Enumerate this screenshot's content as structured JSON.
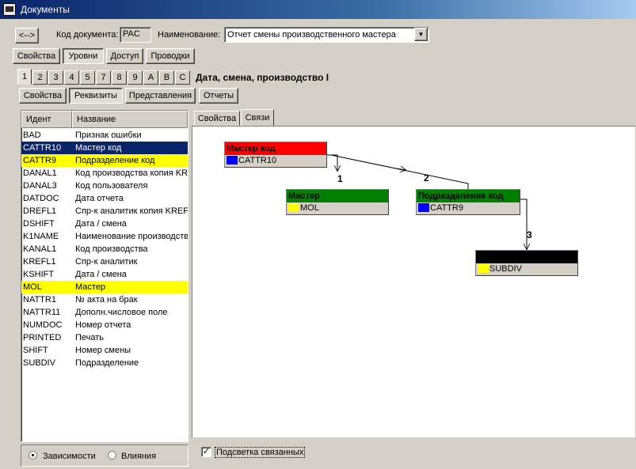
{
  "window": {
    "title": "Документы"
  },
  "header": {
    "nav_button_label": "<-->",
    "doc_code_label": "Код документа:",
    "doc_code_value": "PAC",
    "name_label": "Наименование:",
    "name_value": "Отчет смены производственного мастера"
  },
  "top_tabs": [
    "Свойства",
    "Уровни",
    "Доступ",
    "Проводки"
  ],
  "level_tabs": {
    "items": [
      "1",
      "2",
      "3",
      "4",
      "5",
      "7",
      "8",
      "9",
      "A",
      "B",
      "C"
    ],
    "caption": "Дата, смена, производство I"
  },
  "section_tabs": [
    "Свойства",
    "Реквизиты",
    "Представления",
    "Отчеты"
  ],
  "list": {
    "col_id": "Идент",
    "col_name": "Название",
    "rows": [
      {
        "id": "BAD",
        "name": "Признак ошибки"
      },
      {
        "id": "CATTR10",
        "name": "Мастер код"
      },
      {
        "id": "CATTR9",
        "name": "Подразделение код"
      },
      {
        "id": "DANAL1",
        "name": "Код производства копия KR"
      },
      {
        "id": "DANAL3",
        "name": "Код пользователя"
      },
      {
        "id": "DATDOC",
        "name": "Дата отчета"
      },
      {
        "id": "DREFL1",
        "name": "Спр-к аналитик копия KREF"
      },
      {
        "id": "DSHIFT",
        "name": "Дата / смена"
      },
      {
        "id": "K1NAME",
        "name": "Наименование производстве"
      },
      {
        "id": "KANAL1",
        "name": "Код производства"
      },
      {
        "id": "KREFL1",
        "name": "Спр-к аналитик"
      },
      {
        "id": "KSHIFT",
        "name": "Дата / смена"
      },
      {
        "id": "MOL",
        "name": "Мастер"
      },
      {
        "id": "NATTR1",
        "name": "№ акта на брак"
      },
      {
        "id": "NATTR11",
        "name": "Дополн.числовое поле"
      },
      {
        "id": "NUMDOC",
        "name": "Номер отчета"
      },
      {
        "id": "PRINTED",
        "name": "Печать"
      },
      {
        "id": "SHIFT",
        "name": "Номер смены"
      },
      {
        "id": "SUBDIV",
        "name": "Подразделение"
      }
    ]
  },
  "radio": {
    "dependencies": "Зависимости",
    "influences": "Влияния"
  },
  "right_tabs": [
    "Свойства",
    "Связи"
  ],
  "diagram": {
    "nodes": [
      {
        "title": "Мастер код",
        "field": "CATTR10",
        "header_color": "#ff0000",
        "swatch_color": "#0000ff"
      },
      {
        "title": "Мастер",
        "field": "MOL",
        "header_color": "#008000",
        "swatch_color": "#ffff00"
      },
      {
        "title": "Подразделение код",
        "field": "CATTR9",
        "header_color": "#008000",
        "swatch_color": "#0000ff"
      },
      {
        "title": "",
        "field": "SUBDIV",
        "header_color": "#000000",
        "swatch_color": "#ffff00"
      }
    ],
    "edge_labels": [
      "1",
      "2",
      "3"
    ]
  },
  "footer": {
    "highlight_label": "Подсветка связанных",
    "checkmark": "✓"
  }
}
